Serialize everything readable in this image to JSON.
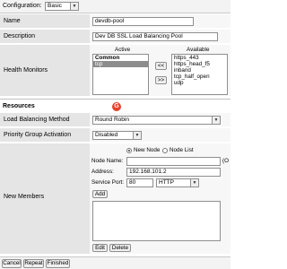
{
  "header": {
    "configuration_label": "Configuration:",
    "configuration_value": "Basic"
  },
  "general": {
    "name_label": "Name",
    "name_value": "devdb-pool",
    "description_label": "Description",
    "description_value": "Dev DB SSL Load Balancing Pool",
    "health_label": "Health Monitors",
    "active_label": "Active",
    "available_label": "Available",
    "active_items": [
      "Common",
      "tcp"
    ],
    "available_items": [
      "https_443",
      "https_head_f5",
      "inband",
      "tcp_half_open",
      "udp"
    ],
    "move_left": "<<",
    "move_right": ">>"
  },
  "resources": {
    "title": "Resources",
    "lb_method_label": "Load Balancing Method",
    "lb_method_value": "Round Robin",
    "priority_label": "Priority Group Activation",
    "priority_value": "Disabled",
    "new_members_label": "New Members",
    "new_node_option": "New Node",
    "node_list_option": "Node List",
    "node_name_label": "Node Name:",
    "node_name_suffix": "(O",
    "address_label": "Address:",
    "address_value": "192.168.101.2",
    "service_port_label": "Service Port:",
    "service_port_value": "80",
    "service_protocol": "HTTP",
    "add_button": "Add",
    "edit_button": "Edit",
    "delete_button": "Delete"
  },
  "footer": {
    "cancel": "Cancel",
    "repeat": "Repeat",
    "finished": "Finished"
  },
  "colors": {
    "label_bg": "#e5e5e5",
    "value_bg": "#f7f7f7",
    "selected_bg": "#8c8c8c",
    "logo": "#e8412c"
  },
  "icons": [
    "chevron-down-icon",
    "f5-logo-icon"
  ]
}
